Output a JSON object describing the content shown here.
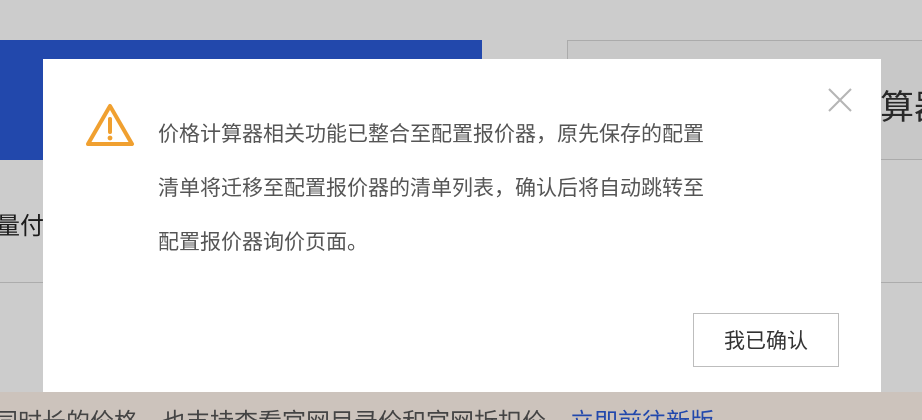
{
  "background": {
    "right_card_text": "算器",
    "left_label": "量付",
    "bottom_text": "同时长的价格，也支持查看官网目录价和官网折扣价。",
    "bottom_link": "立即前往新版"
  },
  "modal": {
    "icon": "warning-triangle-icon",
    "icon_color": "#f0a030",
    "close_icon": "close-icon",
    "message_lines": [
      "价格计算器相关功能已整合至配置报价器，原先保存的配置",
      "清单将迁移至配置报价器的清单列表，确认后将自动跳转至",
      "配置报价器询价页面。"
    ],
    "confirm_label": "我已确认"
  },
  "colors": {
    "brand_blue": "#2b5bd7",
    "overlay": "rgba(0,0,0,0.20)"
  }
}
